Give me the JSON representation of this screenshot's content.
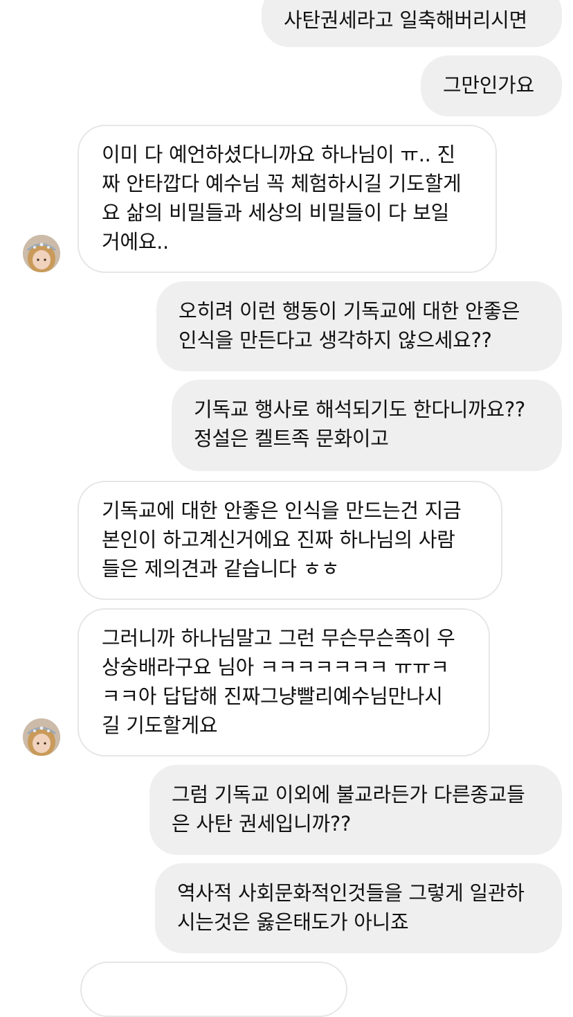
{
  "messages": [
    {
      "direction": "sent",
      "text": "사탄권세라고 일축해버리시면"
    },
    {
      "direction": "sent",
      "text": "그만인가요"
    },
    {
      "direction": "received",
      "text": "이미 다 예언하셨다니까요 하나님이 ㅠ.. 진\n짜 안타깝다 예수님 꼭 체험하시길 기도할게\n요 삶의 비밀들과 세상의 비밀들이 다 보일\n거에요.."
    },
    {
      "direction": "sent",
      "text": "오히려 이런 행동이 기독교에 대한 안좋은\n인식을 만든다고 생각하지 않으세요??"
    },
    {
      "direction": "sent",
      "text": "기독교 행사로 해석되기도 한다니까요??\n정설은 켈트족 문화이고"
    },
    {
      "direction": "received",
      "text": "기독교에 대한 안좋은 인식을 만드는건 지금\n본인이 하고계신거에요 진짜 하나님의 사람\n들은 제의견과 같습니다 ㅎㅎ"
    },
    {
      "direction": "received",
      "text": "그러니까 하나님말고 그런 무슨무슨족이 우\n상숭배라구요 님아 ㅋㅋㅋㅋㅋㅋㅋ ㅠㅠㅋ\nㅋㅋ아 답답해 진짜그냥빨리예수님만나시\n길 기도할게요"
    },
    {
      "direction": "sent",
      "text": "그럼 기독교 이외에 불교라든가 다른종교들\n은 사탄 권세입니까??"
    },
    {
      "direction": "sent",
      "text": "역사적 사회문화적인것들을 그렇게 일관하\n시는것은 옳은태도가 아니죠"
    }
  ],
  "avatar": {
    "icon": "profile-photo-avatar"
  },
  "colors": {
    "sent_bubble": "#efefef",
    "received_border": "#e6e6e6",
    "background": "#ffffff",
    "text": "#111111"
  }
}
